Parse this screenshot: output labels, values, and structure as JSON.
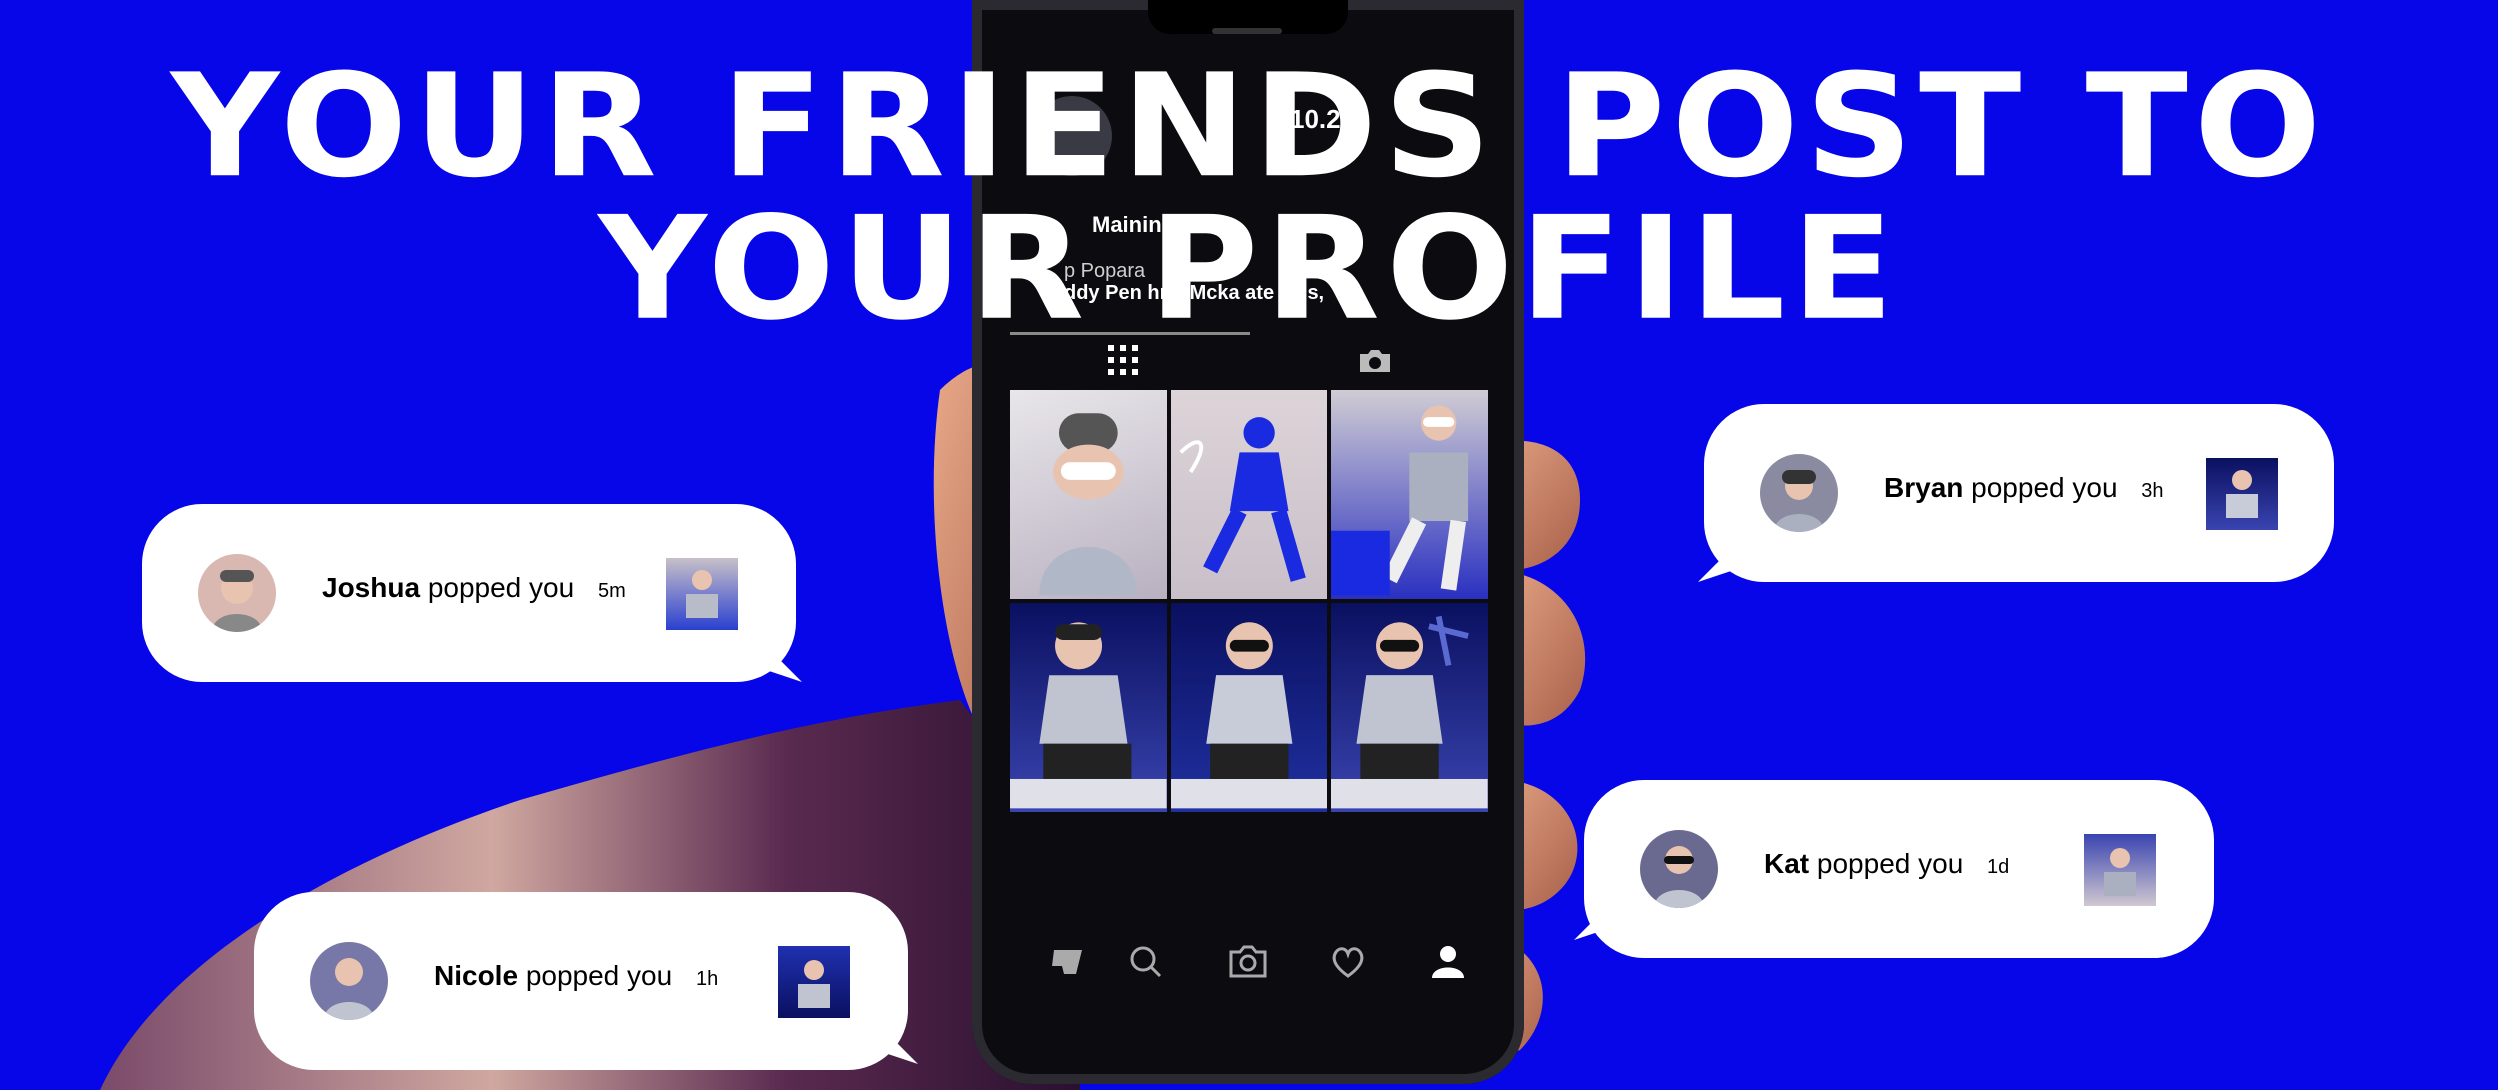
{
  "headline": {
    "line1": "YOUR FRIENDS POST TO",
    "line2": "YOUR PROFILE"
  },
  "phone": {
    "time": "10.2(",
    "profile_name": "Mainini",
    "popped_by_prefix": "p Popara",
    "popped_by_names": "ddy Pen  hris Mcka  ate Ja  s,",
    "tabs": [
      "grid-icon",
      "camera-icon"
    ],
    "nav": [
      "app-logo-icon",
      "search-icon",
      "camera-icon",
      "heart-icon",
      "profile-icon"
    ]
  },
  "notifications": [
    {
      "name": "Joshua",
      "action": "popped you",
      "time": "5m"
    },
    {
      "name": "Nicole",
      "action": "popped you",
      "time": "1h"
    },
    {
      "name": "Bryan",
      "action": "popped you",
      "time": "3h"
    },
    {
      "name": "Kat",
      "action": "popped you",
      "time": "1d"
    }
  ],
  "colors": {
    "background": "#0606e8",
    "bubble": "#ffffff",
    "phone": "#0c0c10"
  }
}
